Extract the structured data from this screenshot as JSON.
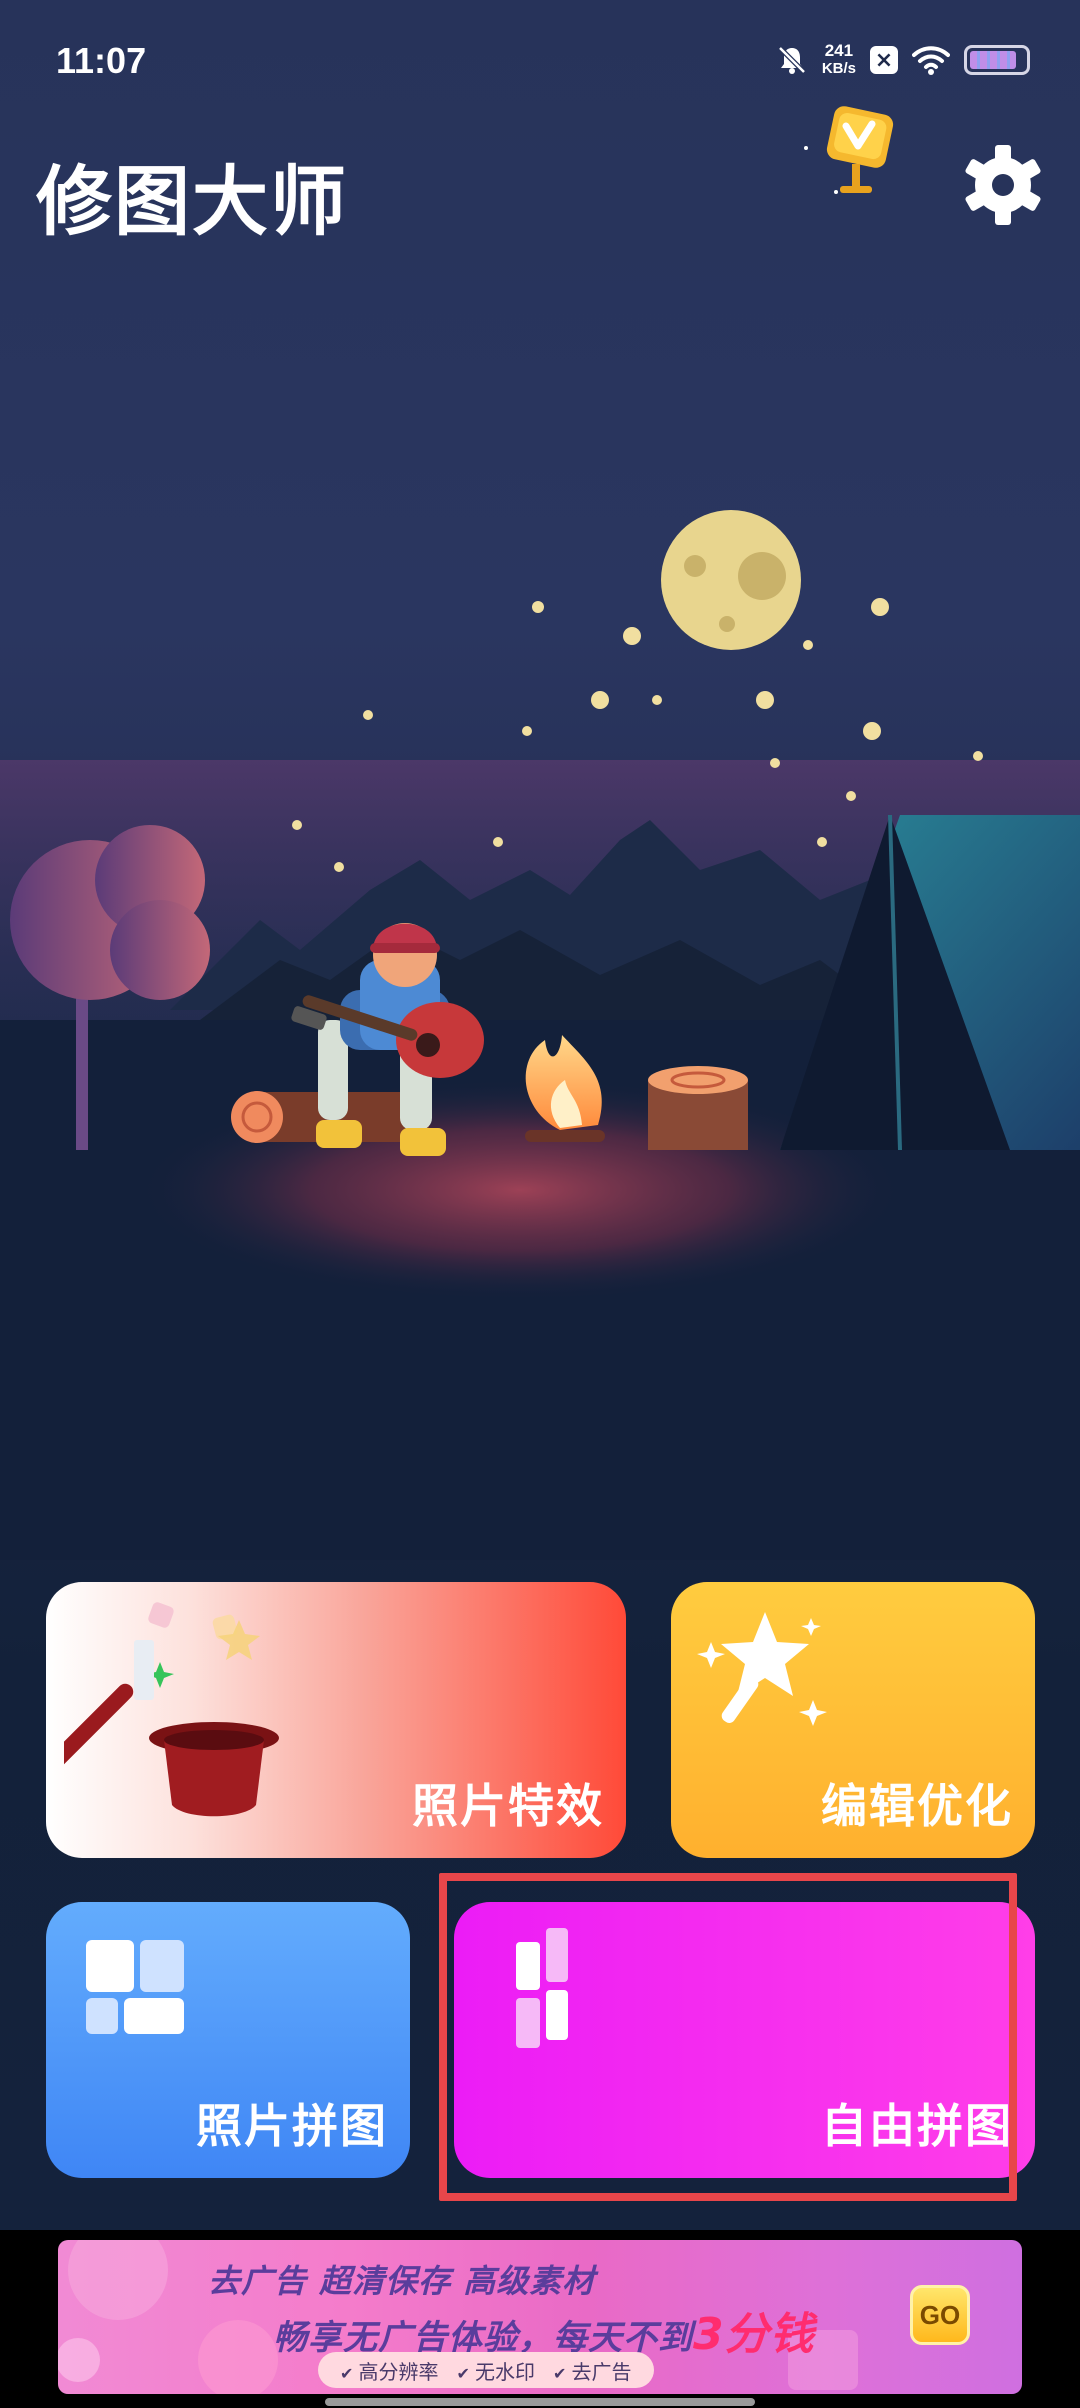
{
  "status_bar": {
    "time": "11:07",
    "net_speed_value": "241",
    "net_speed_unit": "KB/s",
    "sim_badge": "×",
    "icons": [
      "mute-bell-icon",
      "sim-x-icon",
      "wifi-icon",
      "battery-icon"
    ]
  },
  "header": {
    "title": "修图大师",
    "vip_icon": "vip-badge-icon",
    "settings_icon": "gear-icon"
  },
  "cards": {
    "effects": {
      "label": "照片特效",
      "icon": "magic-hat-icon",
      "color": "#ff4a38"
    },
    "edit": {
      "label": "编辑优化",
      "icon": "magic-wand-star-icon",
      "color": "#ffb02e"
    },
    "collage": {
      "label": "照片拼图",
      "icon": "grid-collage-icon",
      "color": "#3f86f5"
    },
    "free": {
      "label": "自由拼图",
      "icon": "free-collage-icon",
      "color": "#ec1cf6"
    }
  },
  "ad": {
    "line1": "去广告  超清保存  高级素材",
    "line2_prefix": "畅享无广告体验，每天不到",
    "line2_highlight": "3分钱",
    "features": [
      "高分辨率",
      "无水印",
      "去广告"
    ],
    "go_label": "GO"
  },
  "colors": {
    "highlight_border": "#e8464a",
    "background": "#14203a"
  }
}
